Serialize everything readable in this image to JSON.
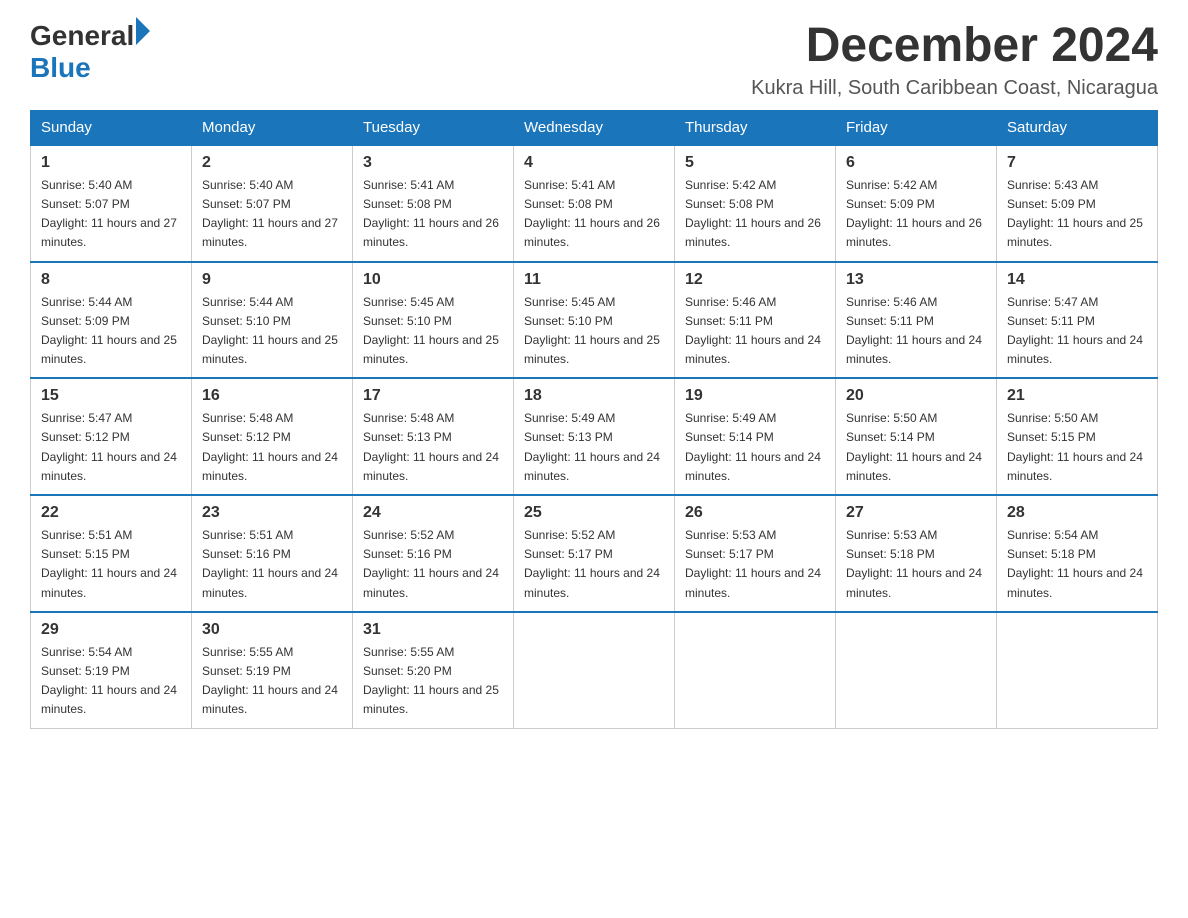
{
  "header": {
    "month_year": "December 2024",
    "location": "Kukra Hill, South Caribbean Coast, Nicaragua"
  },
  "logo": {
    "general": "General",
    "blue": "Blue"
  },
  "days_of_week": [
    "Sunday",
    "Monday",
    "Tuesday",
    "Wednesday",
    "Thursday",
    "Friday",
    "Saturday"
  ],
  "weeks": [
    [
      {
        "day": "1",
        "sunrise": "Sunrise: 5:40 AM",
        "sunset": "Sunset: 5:07 PM",
        "daylight": "Daylight: 11 hours and 27 minutes."
      },
      {
        "day": "2",
        "sunrise": "Sunrise: 5:40 AM",
        "sunset": "Sunset: 5:07 PM",
        "daylight": "Daylight: 11 hours and 27 minutes."
      },
      {
        "day": "3",
        "sunrise": "Sunrise: 5:41 AM",
        "sunset": "Sunset: 5:08 PM",
        "daylight": "Daylight: 11 hours and 26 minutes."
      },
      {
        "day": "4",
        "sunrise": "Sunrise: 5:41 AM",
        "sunset": "Sunset: 5:08 PM",
        "daylight": "Daylight: 11 hours and 26 minutes."
      },
      {
        "day": "5",
        "sunrise": "Sunrise: 5:42 AM",
        "sunset": "Sunset: 5:08 PM",
        "daylight": "Daylight: 11 hours and 26 minutes."
      },
      {
        "day": "6",
        "sunrise": "Sunrise: 5:42 AM",
        "sunset": "Sunset: 5:09 PM",
        "daylight": "Daylight: 11 hours and 26 minutes."
      },
      {
        "day": "7",
        "sunrise": "Sunrise: 5:43 AM",
        "sunset": "Sunset: 5:09 PM",
        "daylight": "Daylight: 11 hours and 25 minutes."
      }
    ],
    [
      {
        "day": "8",
        "sunrise": "Sunrise: 5:44 AM",
        "sunset": "Sunset: 5:09 PM",
        "daylight": "Daylight: 11 hours and 25 minutes."
      },
      {
        "day": "9",
        "sunrise": "Sunrise: 5:44 AM",
        "sunset": "Sunset: 5:10 PM",
        "daylight": "Daylight: 11 hours and 25 minutes."
      },
      {
        "day": "10",
        "sunrise": "Sunrise: 5:45 AM",
        "sunset": "Sunset: 5:10 PM",
        "daylight": "Daylight: 11 hours and 25 minutes."
      },
      {
        "day": "11",
        "sunrise": "Sunrise: 5:45 AM",
        "sunset": "Sunset: 5:10 PM",
        "daylight": "Daylight: 11 hours and 25 minutes."
      },
      {
        "day": "12",
        "sunrise": "Sunrise: 5:46 AM",
        "sunset": "Sunset: 5:11 PM",
        "daylight": "Daylight: 11 hours and 24 minutes."
      },
      {
        "day": "13",
        "sunrise": "Sunrise: 5:46 AM",
        "sunset": "Sunset: 5:11 PM",
        "daylight": "Daylight: 11 hours and 24 minutes."
      },
      {
        "day": "14",
        "sunrise": "Sunrise: 5:47 AM",
        "sunset": "Sunset: 5:11 PM",
        "daylight": "Daylight: 11 hours and 24 minutes."
      }
    ],
    [
      {
        "day": "15",
        "sunrise": "Sunrise: 5:47 AM",
        "sunset": "Sunset: 5:12 PM",
        "daylight": "Daylight: 11 hours and 24 minutes."
      },
      {
        "day": "16",
        "sunrise": "Sunrise: 5:48 AM",
        "sunset": "Sunset: 5:12 PM",
        "daylight": "Daylight: 11 hours and 24 minutes."
      },
      {
        "day": "17",
        "sunrise": "Sunrise: 5:48 AM",
        "sunset": "Sunset: 5:13 PM",
        "daylight": "Daylight: 11 hours and 24 minutes."
      },
      {
        "day": "18",
        "sunrise": "Sunrise: 5:49 AM",
        "sunset": "Sunset: 5:13 PM",
        "daylight": "Daylight: 11 hours and 24 minutes."
      },
      {
        "day": "19",
        "sunrise": "Sunrise: 5:49 AM",
        "sunset": "Sunset: 5:14 PM",
        "daylight": "Daylight: 11 hours and 24 minutes."
      },
      {
        "day": "20",
        "sunrise": "Sunrise: 5:50 AM",
        "sunset": "Sunset: 5:14 PM",
        "daylight": "Daylight: 11 hours and 24 minutes."
      },
      {
        "day": "21",
        "sunrise": "Sunrise: 5:50 AM",
        "sunset": "Sunset: 5:15 PM",
        "daylight": "Daylight: 11 hours and 24 minutes."
      }
    ],
    [
      {
        "day": "22",
        "sunrise": "Sunrise: 5:51 AM",
        "sunset": "Sunset: 5:15 PM",
        "daylight": "Daylight: 11 hours and 24 minutes."
      },
      {
        "day": "23",
        "sunrise": "Sunrise: 5:51 AM",
        "sunset": "Sunset: 5:16 PM",
        "daylight": "Daylight: 11 hours and 24 minutes."
      },
      {
        "day": "24",
        "sunrise": "Sunrise: 5:52 AM",
        "sunset": "Sunset: 5:16 PM",
        "daylight": "Daylight: 11 hours and 24 minutes."
      },
      {
        "day": "25",
        "sunrise": "Sunrise: 5:52 AM",
        "sunset": "Sunset: 5:17 PM",
        "daylight": "Daylight: 11 hours and 24 minutes."
      },
      {
        "day": "26",
        "sunrise": "Sunrise: 5:53 AM",
        "sunset": "Sunset: 5:17 PM",
        "daylight": "Daylight: 11 hours and 24 minutes."
      },
      {
        "day": "27",
        "sunrise": "Sunrise: 5:53 AM",
        "sunset": "Sunset: 5:18 PM",
        "daylight": "Daylight: 11 hours and 24 minutes."
      },
      {
        "day": "28",
        "sunrise": "Sunrise: 5:54 AM",
        "sunset": "Sunset: 5:18 PM",
        "daylight": "Daylight: 11 hours and 24 minutes."
      }
    ],
    [
      {
        "day": "29",
        "sunrise": "Sunrise: 5:54 AM",
        "sunset": "Sunset: 5:19 PM",
        "daylight": "Daylight: 11 hours and 24 minutes."
      },
      {
        "day": "30",
        "sunrise": "Sunrise: 5:55 AM",
        "sunset": "Sunset: 5:19 PM",
        "daylight": "Daylight: 11 hours and 24 minutes."
      },
      {
        "day": "31",
        "sunrise": "Sunrise: 5:55 AM",
        "sunset": "Sunset: 5:20 PM",
        "daylight": "Daylight: 11 hours and 25 minutes."
      },
      null,
      null,
      null,
      null
    ]
  ]
}
